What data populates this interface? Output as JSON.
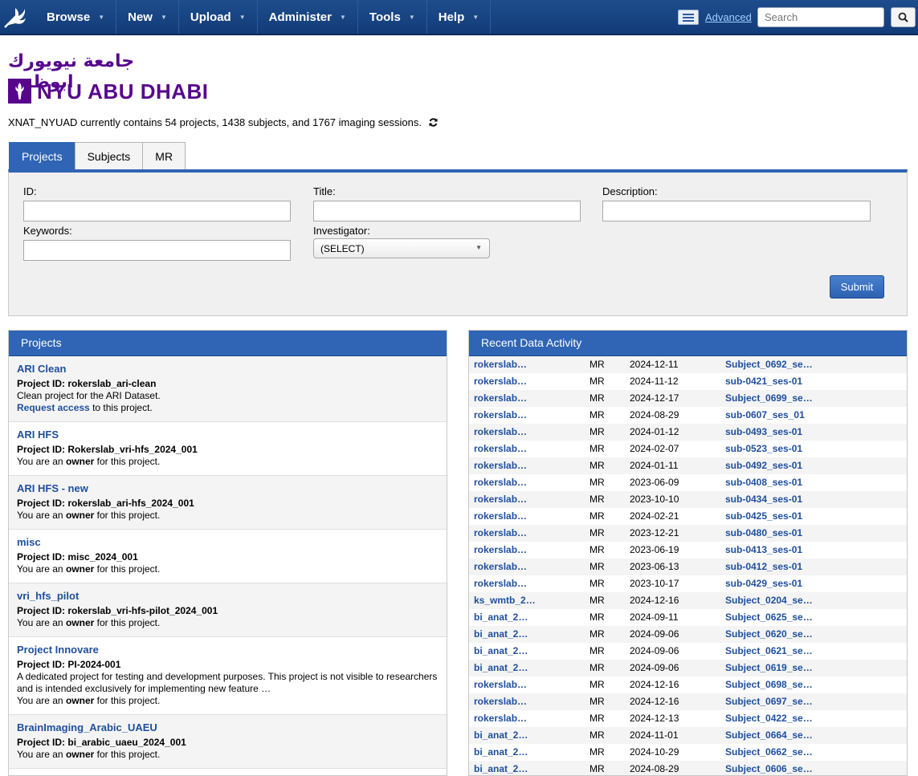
{
  "nav": {
    "items": [
      {
        "label": "Browse"
      },
      {
        "label": "New"
      },
      {
        "label": "Upload"
      },
      {
        "label": "Administer"
      },
      {
        "label": "Tools"
      },
      {
        "label": "Help"
      }
    ],
    "advanced_label": "Advanced",
    "search_placeholder": "Search"
  },
  "branding": {
    "arabic_name": "جامعة نيويورك ابوظبي",
    "english_name": "NYU ABU DHABI"
  },
  "summary": "XNAT_NYUAD currently contains 54 projects, 1438 subjects, and 1767 imaging sessions.",
  "tabs": [
    {
      "label": "Projects",
      "active": true
    },
    {
      "label": "Subjects",
      "active": false
    },
    {
      "label": "MR",
      "active": false
    }
  ],
  "search_form": {
    "id_label": "ID:",
    "title_label": "Title:",
    "description_label": "Description:",
    "keywords_label": "Keywords:",
    "investigator_label": "Investigator:",
    "investigator_value": "(SELECT)",
    "submit_label": "Submit"
  },
  "projects": {
    "header": "Projects",
    "id_prefix": "Project ID: ",
    "items": [
      {
        "title": "ARI Clean",
        "id": "rokerslab_ari-clean",
        "desc": "Clean project for the ARI Dataset.",
        "access_link": "Request access",
        "access_rest": " to this project."
      },
      {
        "title": "ARI HFS",
        "id": "Rokerslab_vri-hfs_2024_001",
        "pre": "You are an ",
        "role": "owner",
        "post": " for this project."
      },
      {
        "title": "ARI HFS - new",
        "id": "rokerslab_ari-hfs_2024_001",
        "pre": "You are an ",
        "role": "owner",
        "post": " for this project."
      },
      {
        "title": "misc",
        "id": "misc_2024_001",
        "pre": "You are an ",
        "role": "owner",
        "post": " for this project."
      },
      {
        "title": "vri_hfs_pilot",
        "id": "rokerslab_vri-hfs-pilot_2024_001",
        "pre": "You are an ",
        "role": "owner",
        "post": " for this project."
      },
      {
        "title": "Project Innovare",
        "id": "PI-2024-001",
        "desc": "A dedicated project for testing and development purposes. This project is not visible to researchers and is intended exclusively for implementing new feature …",
        "pre": "You are an ",
        "role": "owner",
        "post": " for this project."
      },
      {
        "title": "BrainImaging_Arabic_UAEU",
        "id": "bi_arabic_uaeu_2024_001",
        "pre": "You are an ",
        "role": "owner",
        "post": " for this project."
      }
    ]
  },
  "activity": {
    "header": "Recent Data Activity",
    "rows": [
      {
        "project": "rokerslab…",
        "type": "MR",
        "date": "2024-12-11",
        "session": "Subject_0692_se…"
      },
      {
        "project": "rokerslab…",
        "type": "MR",
        "date": "2024-11-12",
        "session": "sub-0421_ses-01"
      },
      {
        "project": "rokerslab…",
        "type": "MR",
        "date": "2024-12-17",
        "session": "Subject_0699_se…"
      },
      {
        "project": "rokerslab…",
        "type": "MR",
        "date": "2024-08-29",
        "session": "sub-0607_ses_01"
      },
      {
        "project": "rokerslab…",
        "type": "MR",
        "date": "2024-01-12",
        "session": "sub-0493_ses-01"
      },
      {
        "project": "rokerslab…",
        "type": "MR",
        "date": "2024-02-07",
        "session": "sub-0523_ses-01"
      },
      {
        "project": "rokerslab…",
        "type": "MR",
        "date": "2024-01-11",
        "session": "sub-0492_ses-01"
      },
      {
        "project": "rokerslab…",
        "type": "MR",
        "date": "2023-06-09",
        "session": "sub-0408_ses-01"
      },
      {
        "project": "rokerslab…",
        "type": "MR",
        "date": "2023-10-10",
        "session": "sub-0434_ses-01"
      },
      {
        "project": "rokerslab…",
        "type": "MR",
        "date": "2024-02-21",
        "session": "sub-0425_ses-01"
      },
      {
        "project": "rokerslab…",
        "type": "MR",
        "date": "2023-12-21",
        "session": "sub-0480_ses-01"
      },
      {
        "project": "rokerslab…",
        "type": "MR",
        "date": "2023-06-19",
        "session": "sub-0413_ses-01"
      },
      {
        "project": "rokerslab…",
        "type": "MR",
        "date": "2023-06-13",
        "session": "sub-0412_ses-01"
      },
      {
        "project": "rokerslab…",
        "type": "MR",
        "date": "2023-10-17",
        "session": "sub-0429_ses-01"
      },
      {
        "project": "ks_wmtb_2…",
        "type": "MR",
        "date": "2024-12-16",
        "session": "Subject_0204_se…"
      },
      {
        "project": "bi_anat_2…",
        "type": "MR",
        "date": "2024-09-11",
        "session": "Subject_0625_se…"
      },
      {
        "project": "bi_anat_2…",
        "type": "MR",
        "date": "2024-09-06",
        "session": "Subject_0620_se…"
      },
      {
        "project": "bi_anat_2…",
        "type": "MR",
        "date": "2024-09-06",
        "session": "Subject_0621_se…"
      },
      {
        "project": "bi_anat_2…",
        "type": "MR",
        "date": "2024-09-06",
        "session": "Subject_0619_se…"
      },
      {
        "project": "rokerslab…",
        "type": "MR",
        "date": "2024-12-16",
        "session": "Subject_0698_se…"
      },
      {
        "project": "rokerslab…",
        "type": "MR",
        "date": "2024-12-16",
        "session": "Subject_0697_se…"
      },
      {
        "project": "rokerslab…",
        "type": "MR",
        "date": "2024-12-13",
        "session": "Subject_0422_se…"
      },
      {
        "project": "bi_anat_2…",
        "type": "MR",
        "date": "2024-11-01",
        "session": "Subject_0664_se…"
      },
      {
        "project": "bi_anat_2…",
        "type": "MR",
        "date": "2024-10-29",
        "session": "Subject_0662_se…"
      },
      {
        "project": "bi_anat_2…",
        "type": "MR",
        "date": "2024-08-29",
        "session": "Subject_0606_se…"
      }
    ]
  }
}
